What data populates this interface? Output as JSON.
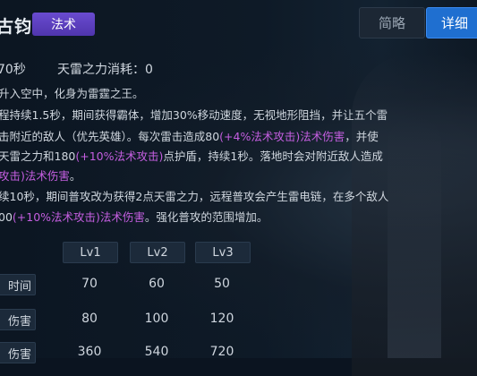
{
  "skill": {
    "name": "古钧",
    "type_tag": "法术"
  },
  "tabs": {
    "brief": "简略",
    "detail": "详细"
  },
  "stats": {
    "cooldown": "70秒",
    "cost": "天雷之力消耗：0"
  },
  "description": {
    "line1": "升入空中，化身为雷霆之王。",
    "line2": "程持续1.5秒，期间获得霸体，增加30%移动速度，无视地形阻挡，并让五个雷",
    "line3_a": "击附近的敌人（优先英雄）。每次雷击造成80",
    "line3_b": "(+4%法术攻击)法术伤害",
    "line3_c": "，并使",
    "line4_a": "天雷之力和180",
    "line4_b": "(+10%法术攻击)",
    "line4_c": "点护盾，持续1秒。落地时会对附近敌人造成",
    "line5_a": "攻击)法术伤害",
    "line5_b": "。",
    "line6": "续10秒，期间普攻改为获得2点天雷之力，远程普攻会产生雷电链，在多个敌人",
    "line7_a": "00",
    "line7_b": "(+10%法术攻击)法术伤害",
    "line7_c": "。强化普攻的范围增加。"
  },
  "levels": {
    "headers": [
      "Lv1",
      "Lv2",
      "Lv3"
    ],
    "rows": [
      {
        "label": "时间",
        "values": [
          "70",
          "60",
          "50"
        ]
      },
      {
        "label": "伤害",
        "values": [
          "80",
          "100",
          "120"
        ]
      },
      {
        "label": "伤害",
        "values": [
          "360",
          "540",
          "720"
        ]
      }
    ]
  },
  "colors": {
    "highlight": "#c45ee0",
    "tag_bg": "#5a3fc0",
    "tab_active": "#1f6fd0"
  }
}
